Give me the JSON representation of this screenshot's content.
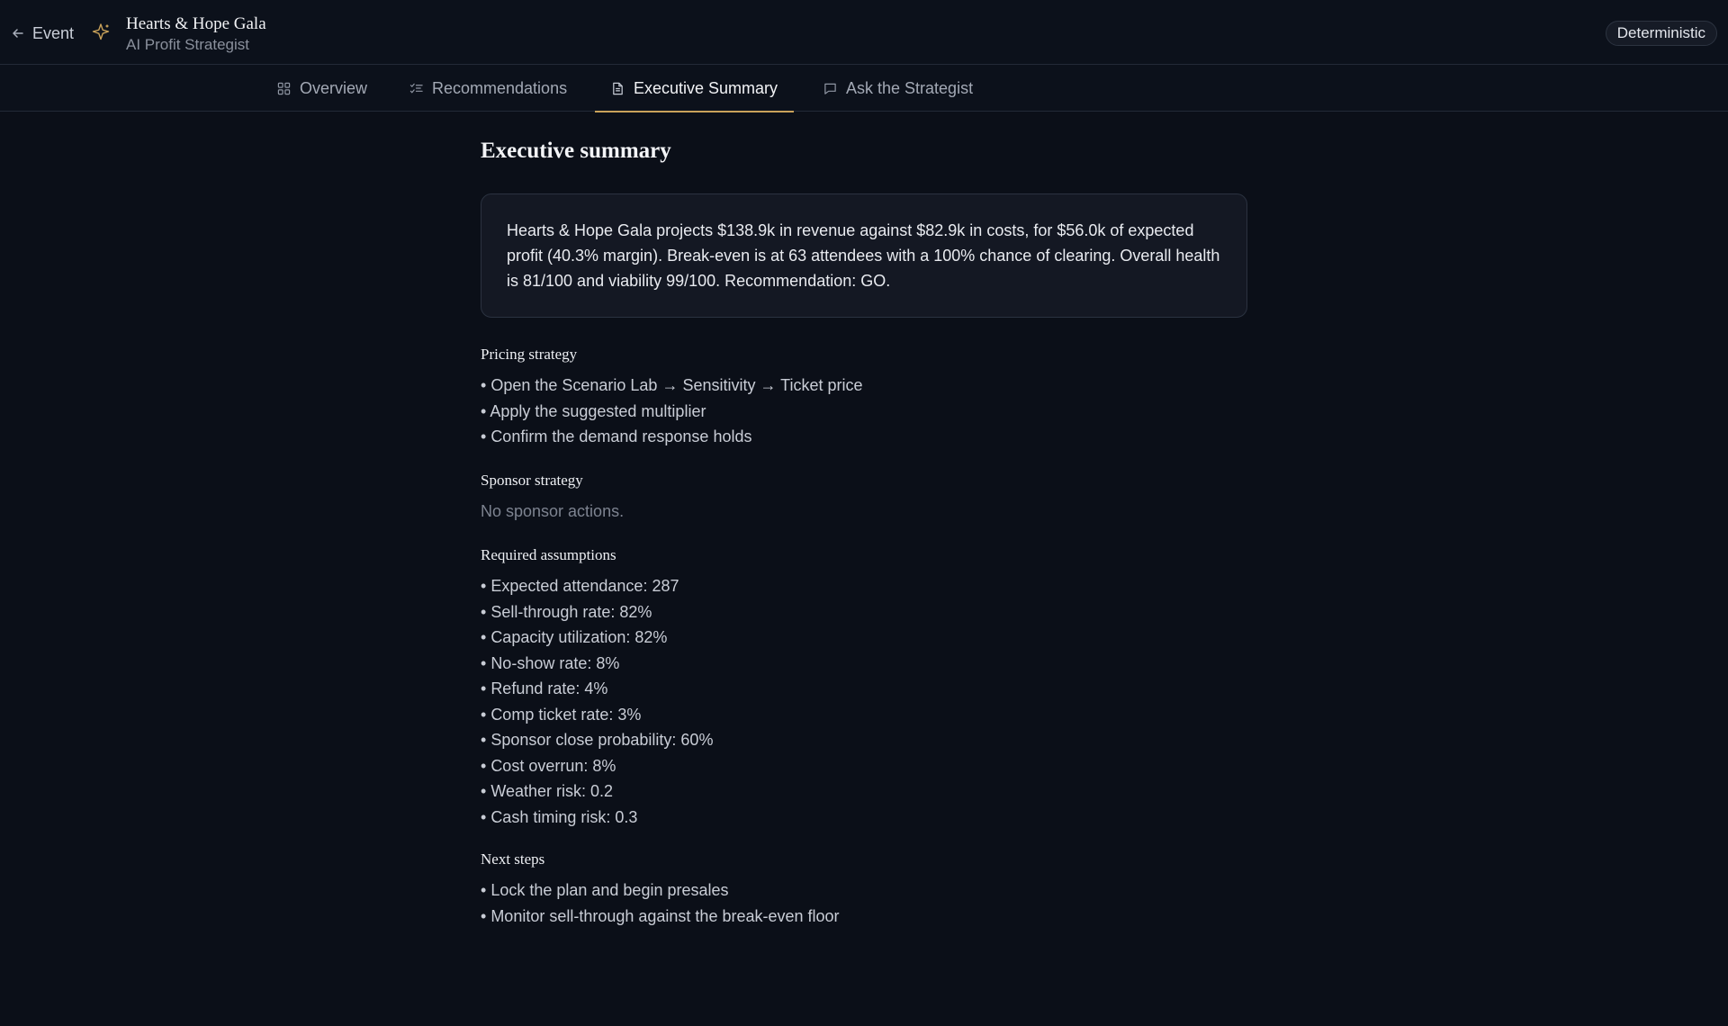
{
  "header": {
    "back_label": "Event",
    "title": "Hearts & Hope Gala",
    "subtitle": "AI Profit Strategist",
    "mode_badge": "Deterministic"
  },
  "tabs": [
    {
      "label": "Overview",
      "icon": "grid-icon",
      "active": false
    },
    {
      "label": "Recommendations",
      "icon": "list-check-icon",
      "active": false
    },
    {
      "label": "Executive Summary",
      "icon": "document-icon",
      "active": true
    },
    {
      "label": "Ask the Strategist",
      "icon": "chat-icon",
      "active": false
    }
  ],
  "summary": {
    "heading": "Executive summary",
    "body": "Hearts & Hope Gala projects $138.9k in revenue against $82.9k in costs, for $56.0k of expected profit (40.3% margin). Break-even is at 63 attendees with a 100% chance of clearing. Overall health is 81/100 and viability 99/100. Recommendation: GO."
  },
  "pricing": {
    "heading": "Pricing strategy",
    "items": [
      "Open the Scenario Lab → Sensitivity → Ticket price",
      "Apply the suggested multiplier",
      "Confirm the demand response holds"
    ]
  },
  "sponsor": {
    "heading": "Sponsor strategy",
    "empty": "No sponsor actions."
  },
  "assumptions": {
    "heading": "Required assumptions",
    "items": [
      "Expected attendance: 287",
      "Sell-through rate: 82%",
      "Capacity utilization: 82%",
      "No-show rate: 8%",
      "Refund rate: 4%",
      "Comp ticket rate: 3%",
      "Sponsor close probability: 60%",
      "Cost overrun: 8%",
      "Weather risk: 0.2",
      "Cash timing risk: 0.3"
    ]
  },
  "next_steps": {
    "heading": "Next steps",
    "items": [
      "Lock the plan and begin presales",
      "Monitor sell-through against the break-even floor"
    ]
  },
  "colors": {
    "background": "#0b0f18",
    "accent": "#c9a25a"
  }
}
